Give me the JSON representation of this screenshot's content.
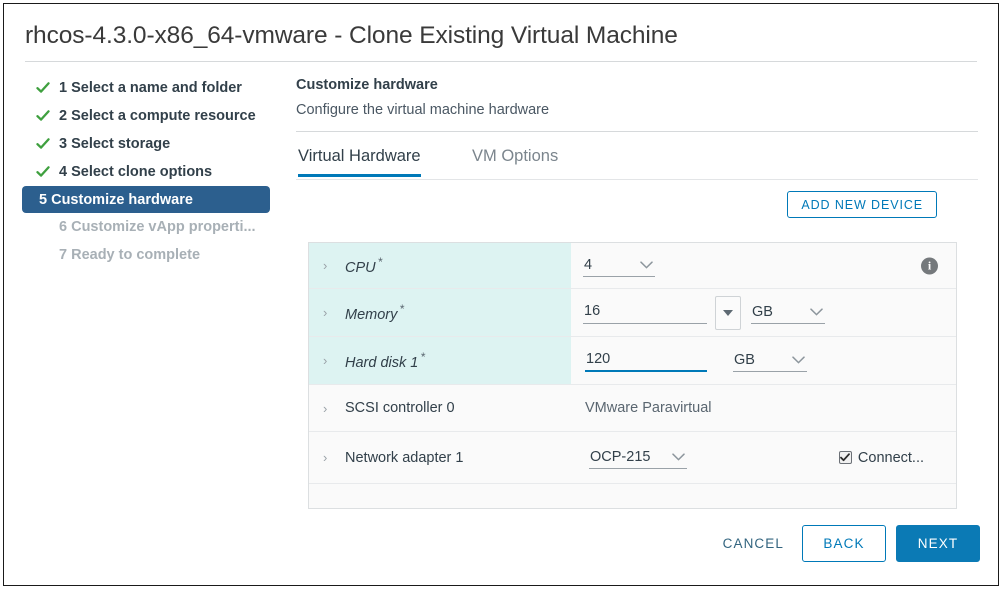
{
  "dialog": {
    "title": "rhcos-4.3.0-x86_64-vmware - Clone Existing Virtual Machine"
  },
  "steps": [
    {
      "label": "1 Select a name and folder",
      "state": "done"
    },
    {
      "label": "2 Select a compute resource",
      "state": "done"
    },
    {
      "label": "3 Select storage",
      "state": "done"
    },
    {
      "label": "4 Select clone options",
      "state": "done"
    },
    {
      "label": "5 Customize hardware",
      "state": "active"
    },
    {
      "label": "6 Customize vApp properti...",
      "state": "disabled"
    },
    {
      "label": "7 Ready to complete",
      "state": "disabled"
    }
  ],
  "pane": {
    "title": "Customize hardware",
    "subtitle": "Configure the virtual machine hardware"
  },
  "tabs": [
    {
      "label": "Virtual Hardware",
      "active": true
    },
    {
      "label": "VM Options",
      "active": false
    }
  ],
  "toolbar": {
    "add_new_device_label": "ADD NEW DEVICE"
  },
  "hardware": {
    "rows": [
      {
        "label": "CPU",
        "required_marker": "*",
        "highlight": true,
        "control": "select",
        "value": "4",
        "info_icon": "i"
      },
      {
        "label": "Memory",
        "required_marker": "*",
        "highlight": true,
        "control": "input-spinner-unit",
        "value": "16",
        "unit": "GB"
      },
      {
        "label": "Hard disk 1",
        "required_marker": "*",
        "highlight": true,
        "control": "input-unit",
        "value": "120",
        "unit": "GB",
        "focused": true
      },
      {
        "label": "SCSI controller 0",
        "required_marker": "",
        "highlight": false,
        "control": "static",
        "value": "VMware Paravirtual"
      },
      {
        "label": "Network adapter 1",
        "required_marker": "",
        "highlight": false,
        "control": "select-checkbox",
        "value": "OCP-215",
        "checkbox_label": "Connect...",
        "checkbox_checked": "true"
      }
    ]
  },
  "footer": {
    "cancel_label": "CANCEL",
    "back_label": "BACK",
    "next_label": "NEXT"
  },
  "colors": {
    "accent_blue": "#0079b8",
    "primary_button": "#0b7ab5",
    "active_step": "#2c5f8e",
    "check_green": "#3fa03f",
    "row_highlight": "#ddf3f2",
    "text_dark": "#32404a"
  }
}
